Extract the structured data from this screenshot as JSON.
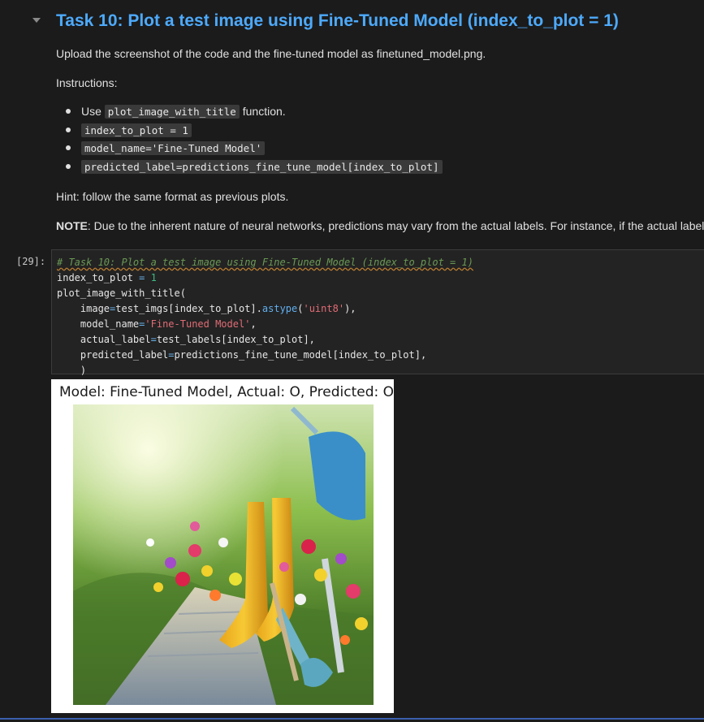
{
  "markdown": {
    "title": "Task 10: Plot a test image using Fine-Tuned Model (index_to_plot = 1)",
    "upload_text": "Upload the screenshot of the code and the fine-tuned model as finetuned_model.png.",
    "instructions_label": "Instructions:",
    "bullets": {
      "b1_prefix": "Use ",
      "b1_code": "plot_image_with_title",
      "b1_suffix": " function.",
      "b2_code": "index_to_plot = 1",
      "b3_code": "model_name='Fine-Tuned Model'",
      "b4_code": "predicted_label=predictions_fine_tune_model[index_to_plot]"
    },
    "hint": "Hint: follow the same format as previous plots.",
    "note_label": "NOTE",
    "note_text": ": Due to the inherent nature of neural networks, predictions may vary from the actual labels. For instance, if the actual label i"
  },
  "code_cell": {
    "prompt": "[29]:",
    "comment": "# Task 10: Plot a test image using Fine-Tuned Model (index_to_plot = 1)"
  },
  "output": {
    "figure_title": "Model: Fine-Tuned Model, Actual: O, Predicted: O"
  },
  "colors": {
    "title": "#4daafc",
    "background": "#1b1b1b",
    "cell_background": "#232323",
    "string": "#e06c75",
    "number": "#41b883"
  }
}
